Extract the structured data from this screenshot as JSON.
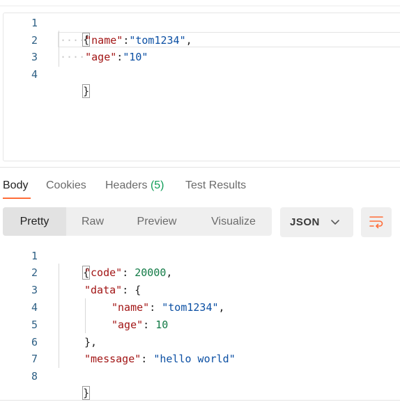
{
  "request_body": {
    "line_numbers": [
      "1",
      "2",
      "3",
      "4"
    ],
    "open_brace": "{",
    "close_brace": "}",
    "dots": "····",
    "name_key": "\"name\"",
    "name_value": "\"tom1234\"",
    "age_key": "\"age\"",
    "age_value": "\"10\"",
    "colon": ":",
    "comma": ","
  },
  "tabs": {
    "body": "Body",
    "cookies": "Cookies",
    "headers": "Headers",
    "headers_count": "(5)",
    "test_results": "Test Results"
  },
  "view_modes": {
    "pretty": "Pretty",
    "raw": "Raw",
    "preview": "Preview",
    "visualize": "Visualize"
  },
  "format_select": {
    "value": "JSON"
  },
  "response_body": {
    "line_numbers": [
      "1",
      "2",
      "3",
      "4",
      "5",
      "6",
      "7",
      "8"
    ],
    "open_brace": "{",
    "close_brace": "}",
    "close_inner": "},",
    "code_key": "\"code\"",
    "code_value": "20000",
    "data_key": "\"data\"",
    "data_open": ": {",
    "name_key": "\"name\"",
    "name_value": "\"tom1234\"",
    "age_key": "\"age\"",
    "age_value": "10",
    "message_key": "\"message\"",
    "message_value": "\"hello world\"",
    "colon_sp": ": ",
    "comma": ","
  },
  "colors": {
    "accent": "#ff6c37",
    "key": "#a21515",
    "string": "#0b4fa3",
    "number": "#117a45",
    "line_number": "#2d5f84",
    "count": "#0f9d58"
  },
  "icons": [
    "chevron-down-icon",
    "wrap-lines-icon"
  ]
}
